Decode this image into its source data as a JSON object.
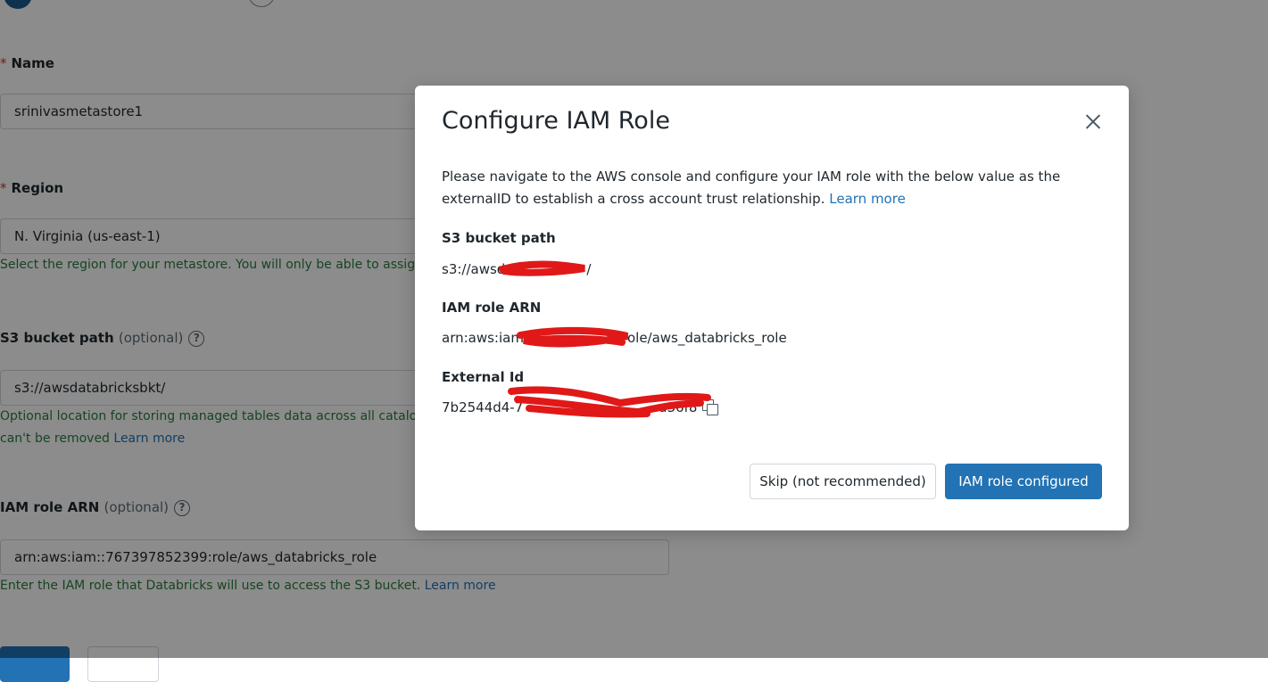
{
  "form": {
    "name_required_marker": "*",
    "name_label": "Name",
    "name_value": "srinivasmetastore1",
    "region_required_marker": "*",
    "region_label": "Region",
    "region_value": "N. Virginia (us-east-1)",
    "region_hint": "Select the region for your metastore. You will only be able to assign wo",
    "s3_label": "S3 bucket path",
    "s3_optional": "(optional)",
    "s3_value": "s3://awsdatabricksbkt/",
    "s3_hint_line1": "Optional location for storing managed tables data across all catalogs i",
    "s3_hint_line2": "can't be removed",
    "s3_hint_link": "Learn more",
    "iam_label": "IAM role ARN",
    "iam_optional": "(optional)",
    "iam_value": "arn:aws:iam::767397852399:role/aws_databricks_role",
    "iam_hint": "Enter the IAM role that Databricks will use to access the S3 bucket.",
    "iam_hint_link": "Learn more",
    "help_glyph": "?"
  },
  "modal": {
    "title": "Configure IAM Role",
    "description": "Please navigate to the AWS console and configure your IAM role with the below value as the externalID to establish a cross account trust relationship.",
    "description_link": "Learn more",
    "s3_label": "S3 bucket path",
    "s3_value": "s3://awsd",
    "s3_value_tail": "/",
    "iam_label": "IAM role ARN",
    "iam_value_prefix": "arn:aws:iam",
    "iam_value_suffix": "ole/aws_databricks_role",
    "external_id_label": "External Id",
    "external_id_prefix": "7b2544d4-7",
    "external_id_suffix": "a36f8",
    "skip_button": "Skip (not recommended)",
    "confirm_button": "IAM role configured"
  },
  "colors": {
    "primary": "#2272b4",
    "hint_green": "#2a7d3c",
    "required_red": "#c0392b",
    "redaction_red": "#e01818"
  },
  "icons": {
    "close": "close-icon",
    "copy": "copy-icon",
    "help": "help-circle-icon"
  }
}
